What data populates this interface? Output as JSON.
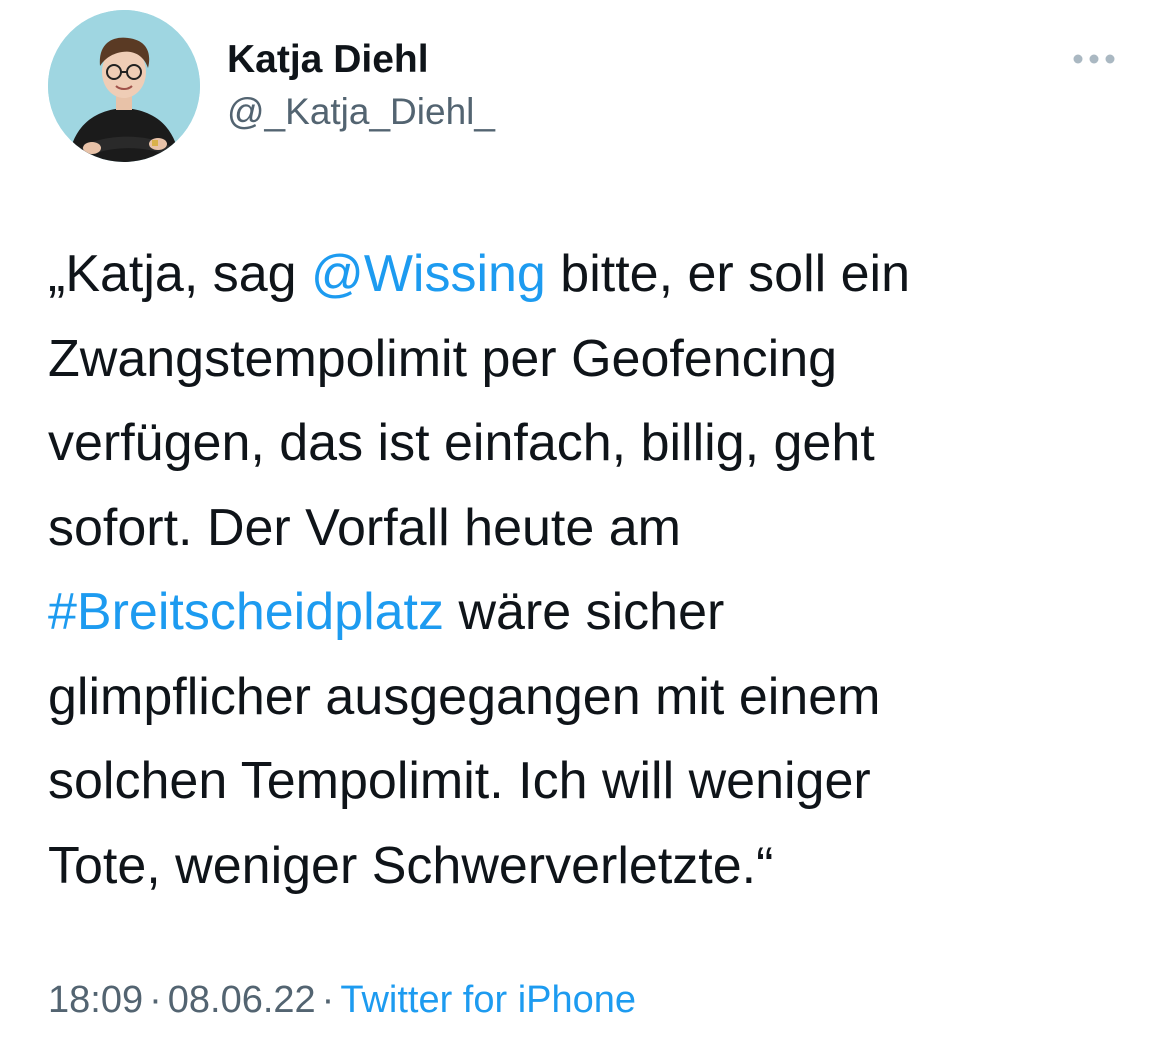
{
  "author": {
    "display_name": "Katja Diehl",
    "handle": "@_Katja_Diehl_"
  },
  "more_icon": "more-horizontal-icon",
  "avatar_icon": "avatar-photo",
  "colors": {
    "link": "#1d9bf0",
    "text": "#0f1419",
    "secondary": "#536471",
    "avatar_bg": "#9fd6e1"
  },
  "tweet": {
    "line1_a": "„Katja, sag ",
    "mention": "@Wissing",
    "line1_b": " bitte, er soll ein",
    "line2": "Zwangstempolimit per Geofencing",
    "line3": "verfügen, das ist einfach, billig, geht",
    "line4": "sofort. Der Vorfall heute am",
    "hashtag": "#Breitscheidplatz",
    "line5_b": " wäre sicher",
    "line6": "glimpflicher ausgegangen mit einem",
    "line7": "solchen Tempolimit. Ich will weniger",
    "line8": "Tote, weniger Schwerverletzte.“"
  },
  "meta": {
    "time": "18:09",
    "separator": "·",
    "date": "08.06.22",
    "source": "Twitter for iPhone"
  }
}
